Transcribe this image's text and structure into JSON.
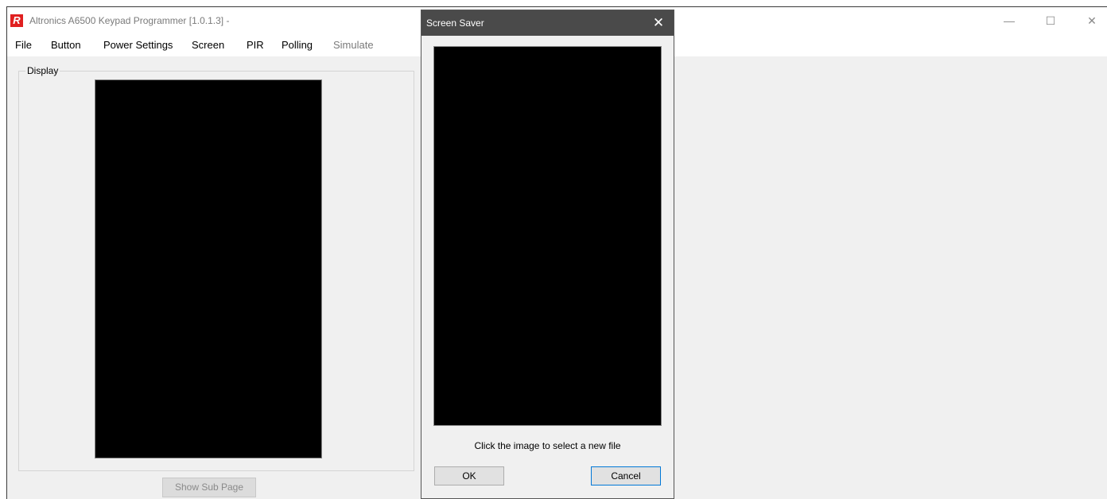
{
  "window": {
    "title": "Altronics A6500 Keypad Programmer [1.0.1.3]  -",
    "logo_text": "R",
    "controls": {
      "minimize": "—",
      "maximize": "☐",
      "close": "✕"
    }
  },
  "menu": {
    "items": [
      {
        "label": "File",
        "enabled": true
      },
      {
        "label": "Button",
        "enabled": true
      },
      {
        "label": "Power Settings",
        "enabled": true
      },
      {
        "label": "Screen",
        "enabled": true
      },
      {
        "label": "PIR",
        "enabled": true
      },
      {
        "label": "Polling",
        "enabled": true
      },
      {
        "label": "Simulate",
        "enabled": false
      }
    ]
  },
  "display": {
    "group_label": "Display",
    "show_sub_page_label": "Show Sub Page"
  },
  "dialog": {
    "title": "Screen Saver",
    "close_glyph": "✕",
    "hint": "Click the image to select a new file",
    "ok_label": "OK",
    "cancel_label": "Cancel"
  },
  "colors": {
    "dialog_title_bar": "#4a4a4a",
    "logo": "#e02020",
    "focus_border": "#0078d7"
  }
}
